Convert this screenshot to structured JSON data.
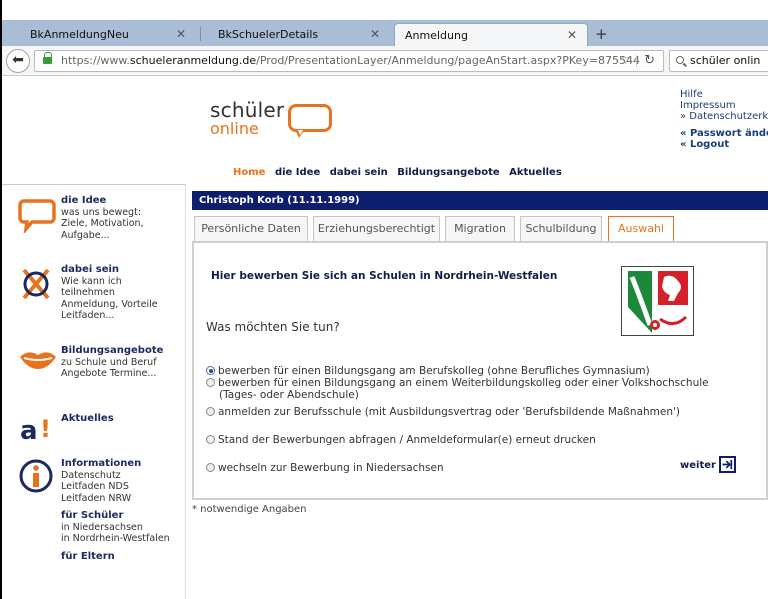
{
  "browser": {
    "tabs": [
      {
        "title": "BkAnmeldungNeu",
        "active": false
      },
      {
        "title": "BkSchuelerDetails",
        "active": false
      },
      {
        "title": "Anmeldung",
        "active": true
      }
    ],
    "url_prefix": "https://www.",
    "url_domain": "schueleranmeldung.de",
    "url_path": "/Prod/PresentationLayer/Anmeldung/pageAnStart.aspx?PKey=875544",
    "search_text": "schüler onlin"
  },
  "header": {
    "logo_line1": "schüler",
    "logo_line2": "online",
    "toplinks": [
      "Hilfe",
      "Impressum",
      "» Datenschutzerk",
      "« Passwort ände",
      "« Logout"
    ],
    "mainnav": [
      "Home",
      "die Idee",
      "dabei sein",
      "Bildungsangebote",
      "Aktuelles"
    ]
  },
  "sidebar": [
    {
      "heading": "die Idee",
      "lines": [
        "was uns bewegt:",
        "Ziele, Motivation,",
        "Aufgabe..."
      ]
    },
    {
      "heading": "dabei sein",
      "lines": [
        "Wie kann ich",
        "teilnehmen",
        "Anmeldung, Vorteile",
        "Leitfaden..."
      ]
    },
    {
      "heading": "Bildungsangebote",
      "lines": [
        "zu Schule und Beruf",
        "Angebote Termine..."
      ]
    },
    {
      "heading": "Aktuelles",
      "lines": []
    },
    {
      "heading": "Informationen",
      "lines": [
        "Datenschutz",
        "Leitfaden NDS",
        "Leitfaden NRW"
      ]
    },
    {
      "heading": "für Schüler",
      "lines": [
        "in Niedersachsen",
        "in Nordrhein-Westfalen"
      ]
    },
    {
      "heading": "für Eltern",
      "lines": []
    }
  ],
  "student_bar": "Christoph Korb (11.11.1999)",
  "content_tabs": [
    "Persönliche Daten",
    "Erziehungsberechtigt",
    "Migration",
    "Schulbildung",
    "Auswahl"
  ],
  "panel": {
    "title": "Hier bewerben Sie sich an Schulen in Nordrhein-Westfalen",
    "question": "Was möchten Sie tun?",
    "options": [
      {
        "line1": "bewerben für einen Bildungsgang am Berufskolleg (ohne Berufliches Gymnasium)",
        "line2": "",
        "checked": true
      },
      {
        "line1": "bewerben für einen Bildungsgang an einem Weiterbildungskolleg oder einer Volkshochschule",
        "line2": "(Tages- oder Abendschule)",
        "checked": false
      },
      {
        "line1": "anmelden zur Berufsschule (mit Ausbildungsvertrag oder 'Berufsbildende Maßnahmen')",
        "line2": "",
        "checked": false
      },
      {
        "line1": "Stand der Bewerbungen abfragen / Anmeldeformular(e) erneut drucken",
        "line2": "",
        "checked": false
      },
      {
        "line1": "wechseln zur Bewerbung in Niedersachsen",
        "line2": "",
        "checked": false
      }
    ],
    "next_label": "weiter"
  },
  "footnote": "* notwendige Angaben",
  "colors": {
    "accent": "#e8731e",
    "navy": "#0e1e6e"
  }
}
